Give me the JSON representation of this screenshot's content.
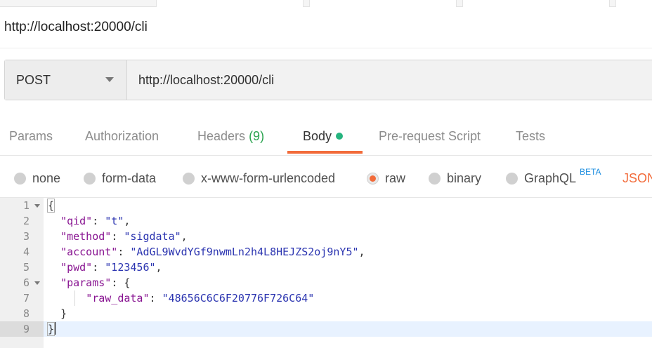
{
  "request": {
    "name": "http://localhost:20000/cli",
    "method": "POST",
    "url": "http://localhost:20000/cli"
  },
  "tabs": [
    {
      "label": "Params"
    },
    {
      "label": "Authorization"
    },
    {
      "label": "Headers",
      "count": "(9)"
    },
    {
      "label": "Body"
    },
    {
      "label": "Pre-request Script"
    },
    {
      "label": "Tests"
    }
  ],
  "body_types": {
    "none": "none",
    "form_data": "form-data",
    "urlencoded": "x-www-form-urlencoded",
    "raw": "raw",
    "binary": "binary",
    "graphql": "GraphQL",
    "beta": "BETA",
    "format": "JSON",
    "selected": "raw"
  },
  "editor": {
    "line_numbers": [
      "1",
      "2",
      "3",
      "4",
      "5",
      "6",
      "7",
      "8",
      "9"
    ],
    "fields": {
      "qid_key": "\"qid\"",
      "qid_val": "\"t\"",
      "method_key": "\"method\"",
      "method_val": "\"sigdata\"",
      "account_key": "\"account\"",
      "account_val": "\"AdGL9WvdYGf9nwmLn2h4L8HEJZS2oj9nY5\"",
      "pwd_key": "\"pwd\"",
      "pwd_val": "\"123456\"",
      "params_key": "\"params\"",
      "raw_data_key": "\"raw_data\"",
      "raw_data_val": "\"48656C6C6F20776F726C64\""
    },
    "current_line": 9
  },
  "colors": {
    "accent": "#f26b3a",
    "body_dot": "#26b47f",
    "headers_count": "#2aa34f",
    "json_key": "#881391",
    "json_string": "#2b34b0",
    "beta": "#1f8fe0"
  }
}
